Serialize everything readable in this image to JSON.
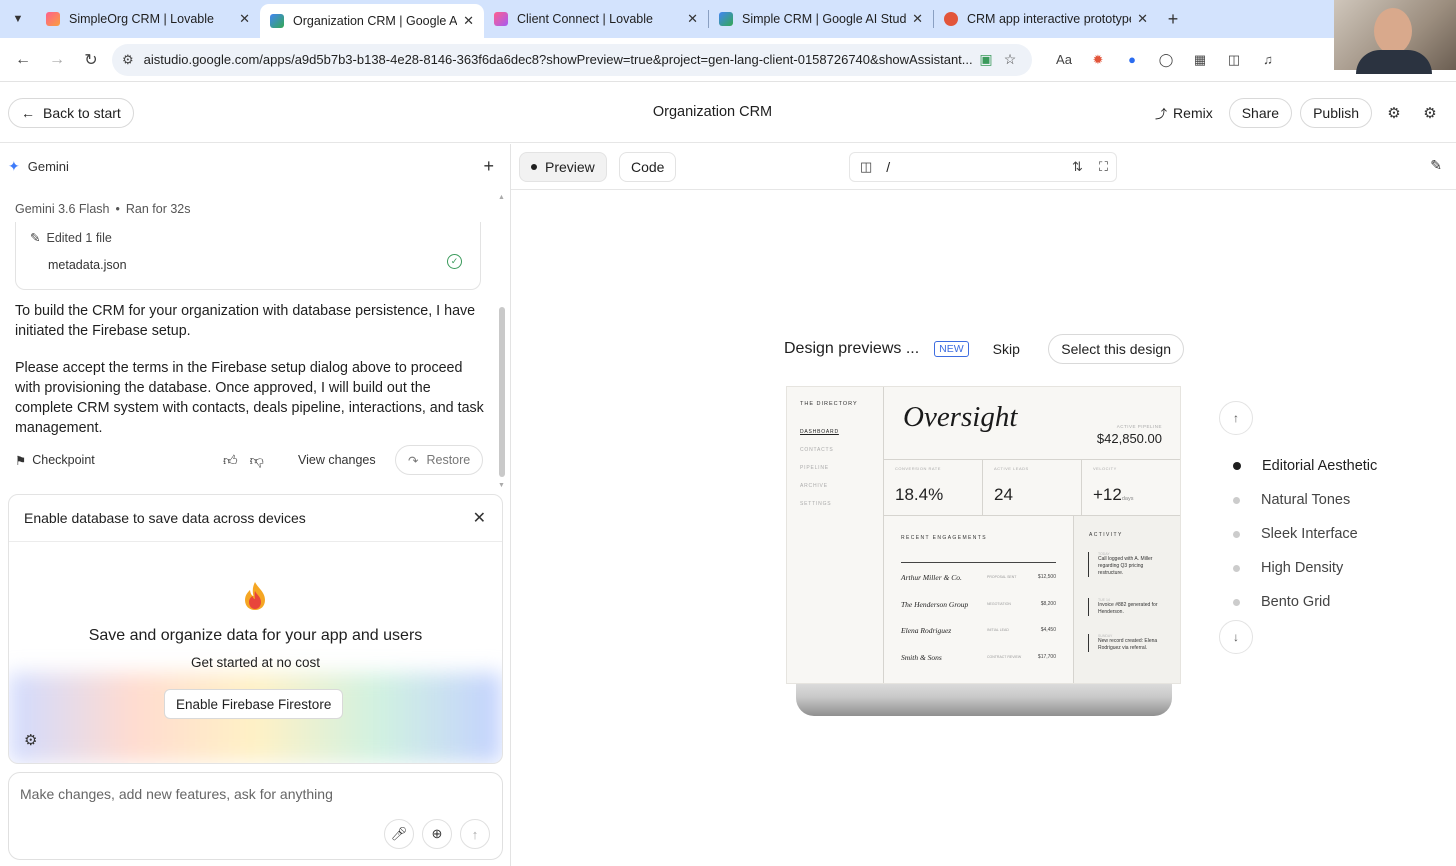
{
  "browser": {
    "tabs": [
      {
        "title": "SimpleOrg CRM | Lovable",
        "color": "#e0457b",
        "active": false
      },
      {
        "title": "Organization CRM | Google AI Studio",
        "color": "#4285f4",
        "active": true
      },
      {
        "title": "Client Connect | Lovable",
        "color": "#e0457b",
        "active": false
      },
      {
        "title": "Simple CRM | Google AI Studio",
        "color": "#4285f4",
        "active": false
      },
      {
        "title": "CRM app interactive prototype",
        "color": "#e2553a",
        "active": false
      }
    ],
    "url": "aistudio.google.com/apps/a9d5b7b3-b138-4e28-8146-363f6da6dec8?showPreview=true&project=gen-lang-client-0158726740&showAssistant..."
  },
  "header": {
    "back_label": "Back to start",
    "title": "Organization CRM",
    "remix_label": "Remix",
    "share_label": "Share",
    "publish_label": "Publish"
  },
  "chat": {
    "assistant_name": "Gemini",
    "model": "Gemini 3.6 Flash",
    "run_info": "Ran for 32s",
    "edited_label": "Edited 1 file",
    "edited_file": "metadata.json",
    "message_1": "To build the CRM for your organization with database persistence, I have initiated the Firebase setup.",
    "message_2": "Please accept the terms in the Firebase setup dialog above to proceed with provisioning the database. Once approved, I will build out the complete CRM system with contacts, deals pipeline, interactions, and task management.",
    "checkpoint_label": "Checkpoint",
    "view_changes_label": "View changes",
    "restore_label": "Restore"
  },
  "firebase": {
    "header": "Enable database to save data across devices",
    "title": "Save and organize data for your app and users",
    "subtitle": "Get started at no cost",
    "button_label": "Enable Firebase Firestore"
  },
  "composer": {
    "placeholder": "Make changes, add new features, ask for anything"
  },
  "toolbar": {
    "preview_label": "Preview",
    "code_label": "Code",
    "path": "/"
  },
  "design": {
    "heading": "Design previews ...",
    "badge": "NEW",
    "skip_label": "Skip",
    "select_label": "Select this design",
    "options": [
      "Editorial Aesthetic",
      "Natural Tones",
      "Sleek Interface",
      "High Density",
      "Bento Grid"
    ],
    "active_index": 0
  },
  "preview": {
    "brand": "THE DIRECTORY",
    "nav": [
      "DASHBOARD",
      "CONTACTS",
      "PIPELINE",
      "ARCHIVE",
      "SETTINGS"
    ],
    "title": "Oversight",
    "pipeline_label": "ACTIVE PIPELINE",
    "pipeline_value": "$42,850.00",
    "stats": [
      {
        "label": "CONVERSION RATE",
        "value": "18.4%",
        "unit": ""
      },
      {
        "label": "ACTIVE LEADS",
        "value": "24",
        "unit": ""
      },
      {
        "label": "VELOCITY",
        "value": "+12",
        "unit": "days"
      }
    ],
    "engagements_label": "RECENT ENGAGEMENTS",
    "rows": [
      {
        "name": "Arthur Miller & Co.",
        "status": "PROPOSAL SENT",
        "value": "$12,500"
      },
      {
        "name": "The Henderson Group",
        "status": "NEGOTIATION",
        "value": "$8,200"
      },
      {
        "name": "Elena Rodriguez",
        "status": "INITIAL LEAD",
        "value": "$4,450"
      },
      {
        "name": "Smith & Sons",
        "status": "CONTRACT REVIEW",
        "value": "$17,700"
      }
    ],
    "activity_label": "ACTIVITY",
    "activity": [
      {
        "time": "TODAY",
        "text": "Call logged with A. Miller regarding Q3 pricing restructure."
      },
      {
        "time": "TUE 14",
        "text": "Invoice #882 generated for Henderson."
      },
      {
        "time": "SUNDAY",
        "text": "New record created: Elena Rodriguez via referral."
      }
    ]
  }
}
